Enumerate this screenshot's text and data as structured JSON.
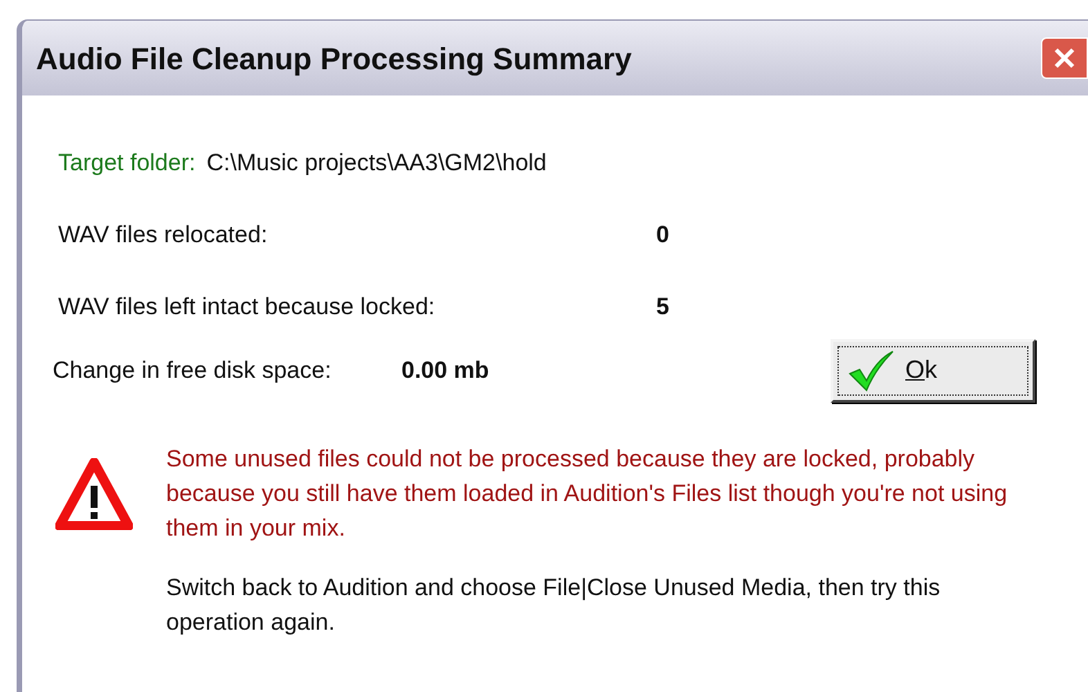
{
  "window": {
    "title": "Audio File Cleanup Processing Summary"
  },
  "target": {
    "label": "Target folder:",
    "path": "C:\\Music projects\\AA3\\GM2\\hold"
  },
  "stats": [
    {
      "label": "WAV files relocated:",
      "value": "0"
    },
    {
      "label": "WAV files left intact because locked:",
      "value": "5"
    }
  ],
  "disk_space": {
    "label": "Change in free disk space:",
    "value": "0.00 mb"
  },
  "ok_button": {
    "label": "Ok"
  },
  "warning": "Some unused files could not be processed because they are locked, probably because you still have them loaded in Audition's Files list though you're not using them in your mix.",
  "instruction": "Switch back to Audition and choose File|Close Unused Media, then try this operation again."
}
